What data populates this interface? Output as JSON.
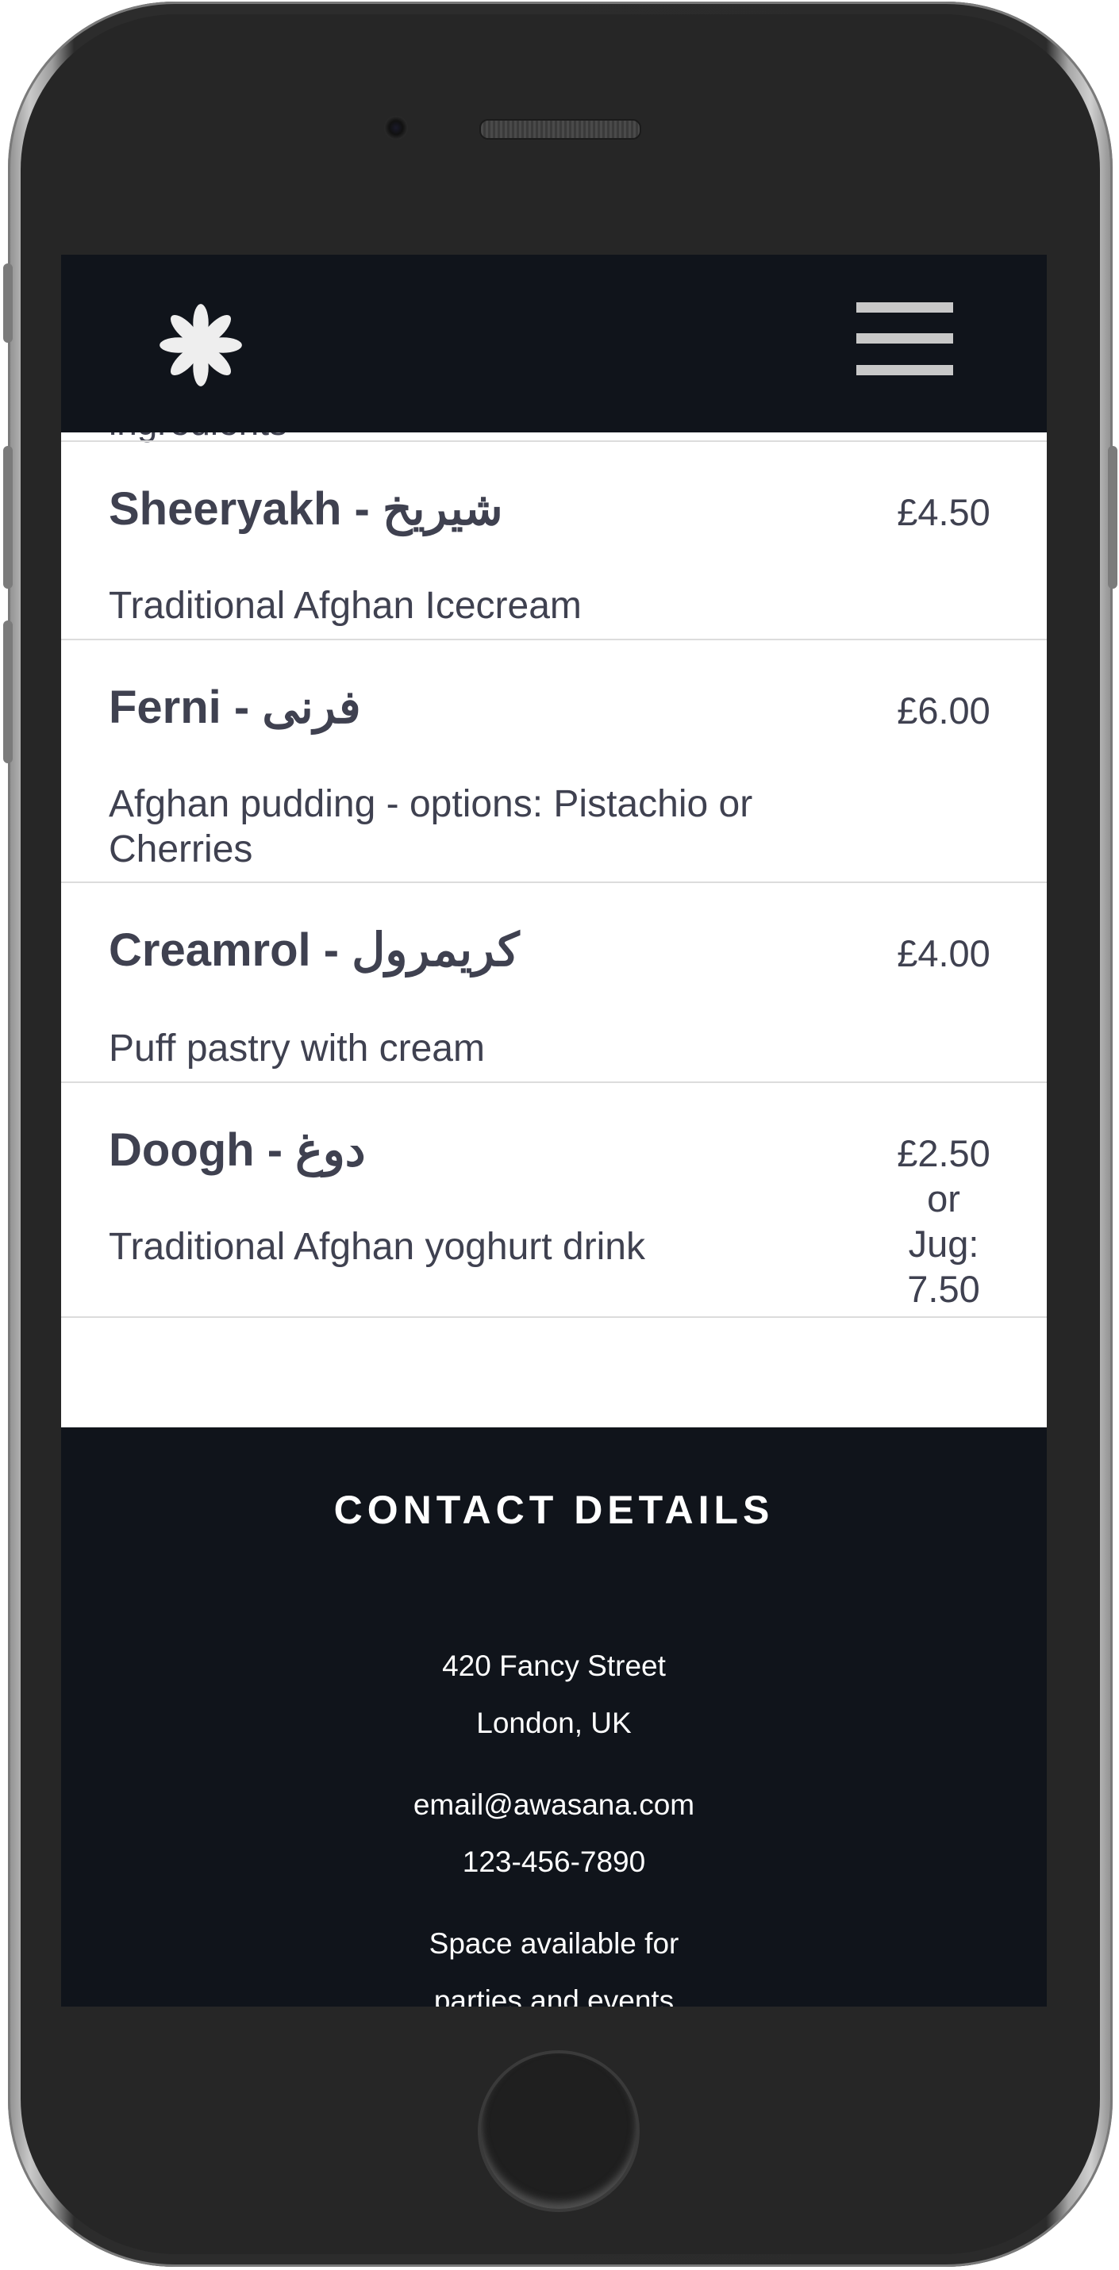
{
  "header": {
    "logo_icon": "asterisk-flower-icon",
    "menu_icon": "hamburger-menu-icon"
  },
  "menu": {
    "clipped_text": "ingredients",
    "items": [
      {
        "name": "Sheeryakh - شیریخ",
        "price": "£4.50",
        "description": "Traditional Afghan Icecream"
      },
      {
        "name": "Ferni - فرنی",
        "price": "£6.00",
        "description": "Afghan pudding - options: Pistachio or Cherries"
      },
      {
        "name": "Creamrol - کریمرول",
        "price": "£4.00",
        "description": "Puff pastry with cream"
      },
      {
        "name": "Doogh - دوغ",
        "price": "£2.50 or Jug: 7.50",
        "description": "Traditional Afghan yoghurt drink"
      }
    ]
  },
  "footer": {
    "title": "CONTACT DETAILS",
    "address_line1": "420 Fancy Street",
    "address_line2": "London, UK",
    "email": "email@awasana.com",
    "phone": "123-456-7890",
    "note_line1": "Space available for",
    "note_line2": "parties and events"
  },
  "colors": {
    "header_bg": "#10141b",
    "text": "#3f4150",
    "footer_text": "#ffffff"
  }
}
